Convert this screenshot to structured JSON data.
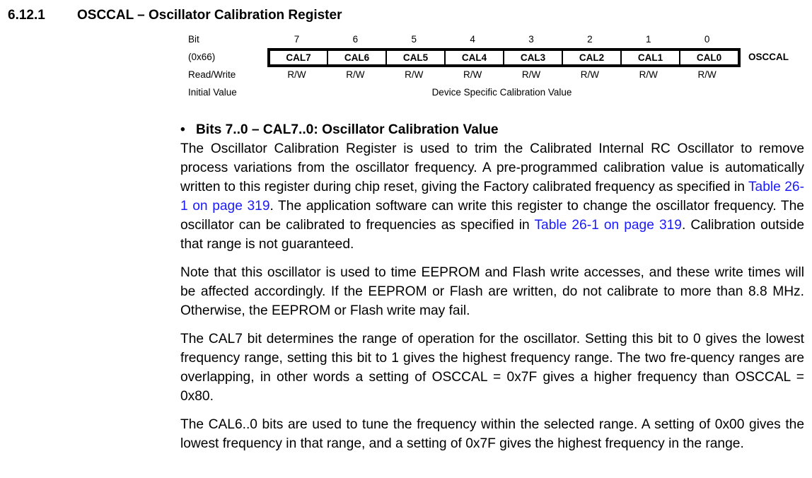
{
  "section": {
    "number": "6.12.1",
    "title": "OSCCAL – Oscillator Calibration Register"
  },
  "register": {
    "row_labels": {
      "bit": "Bit",
      "address": "(0x66)",
      "read_write": "Read/Write",
      "initial_value": "Initial Value"
    },
    "bits": [
      "7",
      "6",
      "5",
      "4",
      "3",
      "2",
      "1",
      "0"
    ],
    "fields": [
      "CAL7",
      "CAL6",
      "CAL5",
      "CAL4",
      "CAL3",
      "CAL2",
      "CAL1",
      "CAL0"
    ],
    "access": [
      "R/W",
      "R/W",
      "R/W",
      "R/W",
      "R/W",
      "R/W",
      "R/W",
      "R/W"
    ],
    "name": "OSCCAL",
    "initial_value": "Device Specific Calibration Value"
  },
  "description": {
    "bullet": "•",
    "bullet_title": "Bits 7..0 – CAL7..0: Oscillator Calibration Value",
    "p1": {
      "t1": "The Oscillator Calibration Register is used to trim the Calibrated Internal RC Oscillator to remove process variations from the oscillator frequency. A pre-programmed calibration value is automatically written to this register during chip reset, giving the Factory calibrated frequency as specified in ",
      "link1": "Table 26-1 on page 319",
      "t2": ". The application software can write this register to change the oscillator frequency. The oscillator can be calibrated to frequencies as specified in ",
      "link2": "Table 26-1 on page 319",
      "t3": ". Calibration outside that range is not guaranteed."
    },
    "p2": "Note that this oscillator is used to time EEPROM and Flash write accesses, and these write times will be affected accordingly. If the EEPROM or Flash are written, do not calibrate to more than 8.8 MHz. Otherwise, the EEPROM or Flash write may fail.",
    "p3": "The CAL7 bit determines the range of operation for the oscillator. Setting this bit to 0 gives the lowest frequency range, setting this bit to 1 gives the highest frequency range. The two fre-quency ranges are overlapping, in other words a setting of OSCCAL = 0x7F gives a higher frequency than OSCCAL = 0x80.",
    "p4": "The CAL6..0 bits are used to tune the frequency within the selected range. A setting of 0x00 gives the lowest frequency in that range, and a setting of 0x7F gives the highest frequency in the range."
  },
  "colors": {
    "link": "#1a1aff",
    "text": "#000000"
  }
}
